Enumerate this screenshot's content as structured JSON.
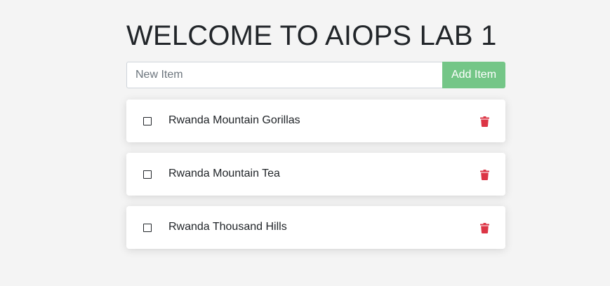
{
  "page": {
    "title": "WELCOME TO AIOPS LAB 1"
  },
  "add_form": {
    "input_placeholder": "New Item",
    "input_value": "",
    "button_label": "Add Item"
  },
  "items": [
    {
      "label": "Rwanda Mountain Gorillas",
      "checked": false
    },
    {
      "label": "Rwanda Mountain Tea",
      "checked": false
    },
    {
      "label": "Rwanda Thousand Hills",
      "checked": false
    }
  ],
  "icons": {
    "checkbox": "checkbox-unchecked-icon",
    "delete": "trash-icon"
  },
  "colors": {
    "background": "#f4f4f4",
    "add_button": "#74c687",
    "delete_icon": "#dc3545",
    "text": "#212529"
  }
}
